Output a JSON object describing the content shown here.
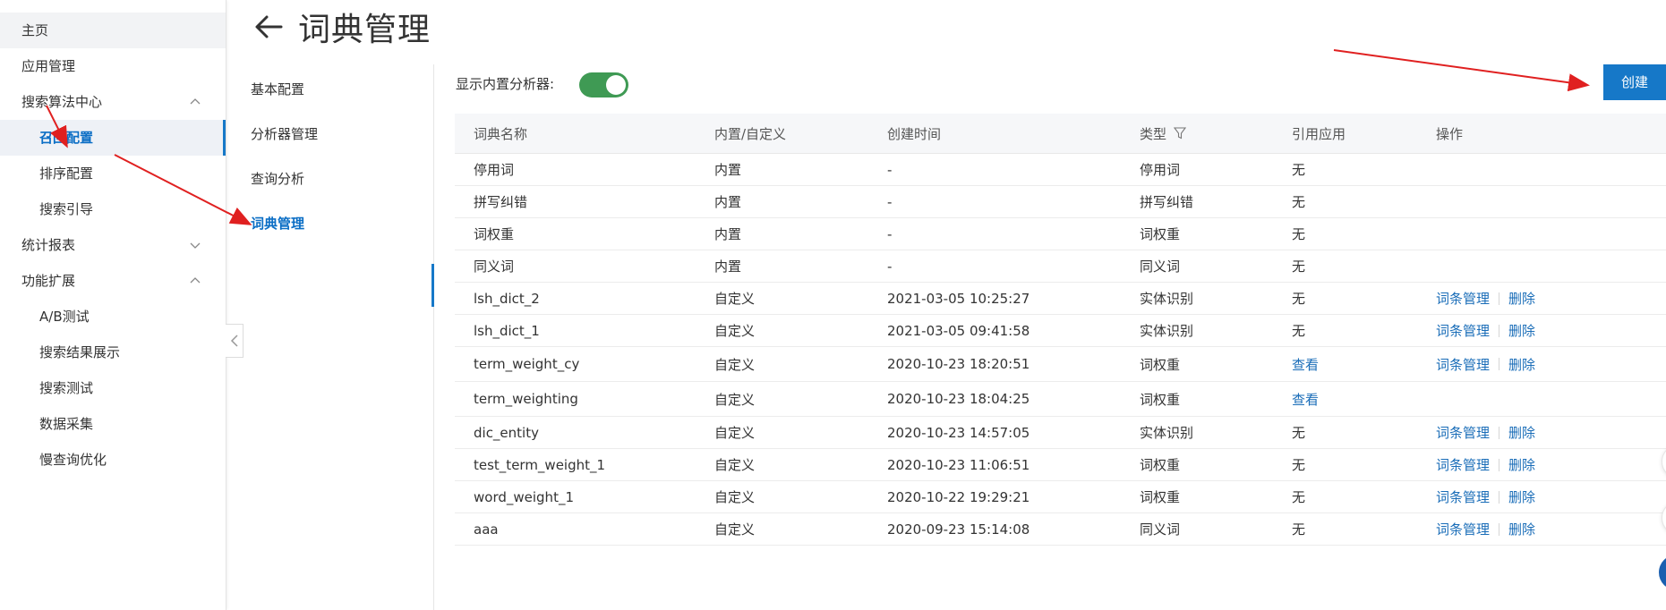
{
  "page": {
    "title": "词典管理"
  },
  "sidebar": {
    "items": [
      {
        "label": "主页",
        "level": "top",
        "chevron": "none",
        "state": "home"
      },
      {
        "label": "应用管理",
        "level": "top",
        "chevron": "none",
        "state": ""
      },
      {
        "label": "搜索算法中心",
        "level": "top",
        "chevron": "up",
        "state": ""
      },
      {
        "label": "召回配置",
        "level": "sub",
        "chevron": "none",
        "state": "active"
      },
      {
        "label": "排序配置",
        "level": "sub",
        "chevron": "none",
        "state": ""
      },
      {
        "label": "搜索引导",
        "level": "sub",
        "chevron": "none",
        "state": ""
      },
      {
        "label": "统计报表",
        "level": "top",
        "chevron": "down",
        "state": ""
      },
      {
        "label": "功能扩展",
        "level": "top",
        "chevron": "up",
        "state": ""
      },
      {
        "label": "A/B测试",
        "level": "sub",
        "chevron": "none",
        "state": ""
      },
      {
        "label": "搜索结果展示",
        "level": "sub",
        "chevron": "none",
        "state": ""
      },
      {
        "label": "搜索测试",
        "level": "sub",
        "chevron": "none",
        "state": ""
      },
      {
        "label": "数据采集",
        "level": "sub",
        "chevron": "none",
        "state": ""
      },
      {
        "label": "慢查询优化",
        "level": "sub",
        "chevron": "none",
        "state": ""
      }
    ]
  },
  "subnav": {
    "items": [
      {
        "label": "基本配置",
        "active": false
      },
      {
        "label": "分析器管理",
        "active": false
      },
      {
        "label": "查询分析",
        "active": false
      },
      {
        "label": "词典管理",
        "active": true
      }
    ]
  },
  "toolbar": {
    "toggle_label": "显示内置分析器:",
    "toggle_on": true,
    "create_label": "创建"
  },
  "table": {
    "headers": [
      "词典名称",
      "内置/自定义",
      "创建时间",
      "类型",
      "引用应用",
      "操作"
    ],
    "rows": [
      {
        "name": "停用词",
        "origin": "内置",
        "created": "-",
        "type": "停用词",
        "ref": "无",
        "ref_link": false,
        "actions": []
      },
      {
        "name": "拼写纠错",
        "origin": "内置",
        "created": "-",
        "type": "拼写纠错",
        "ref": "无",
        "ref_link": false,
        "actions": []
      },
      {
        "name": "词权重",
        "origin": "内置",
        "created": "-",
        "type": "词权重",
        "ref": "无",
        "ref_link": false,
        "actions": []
      },
      {
        "name": "同义词",
        "origin": "内置",
        "created": "-",
        "type": "同义词",
        "ref": "无",
        "ref_link": false,
        "actions": []
      },
      {
        "name": "lsh_dict_2",
        "origin": "自定义",
        "created": "2021-03-05 10:25:27",
        "type": "实体识别",
        "ref": "无",
        "ref_link": false,
        "actions": [
          "词条管理",
          "删除"
        ]
      },
      {
        "name": "lsh_dict_1",
        "origin": "自定义",
        "created": "2021-03-05 09:41:58",
        "type": "实体识别",
        "ref": "无",
        "ref_link": false,
        "actions": [
          "词条管理",
          "删除"
        ]
      },
      {
        "name": "term_weight_cy",
        "origin": "自定义",
        "created": "2020-10-23 18:20:51",
        "type": "词权重",
        "ref": "查看",
        "ref_link": true,
        "actions": [
          "词条管理",
          "删除"
        ]
      },
      {
        "name": "term_weighting",
        "origin": "自定义",
        "created": "2020-10-23 18:04:25",
        "type": "词权重",
        "ref": "查看",
        "ref_link": true,
        "actions": []
      },
      {
        "name": "dic_entity",
        "origin": "自定义",
        "created": "2020-10-23 14:57:05",
        "type": "实体识别",
        "ref": "无",
        "ref_link": false,
        "actions": [
          "词条管理",
          "删除"
        ]
      },
      {
        "name": "test_term_weight_1",
        "origin": "自定义",
        "created": "2020-10-23 11:06:51",
        "type": "词权重",
        "ref": "无",
        "ref_link": false,
        "actions": [
          "词条管理",
          "删除"
        ]
      },
      {
        "name": "word_weight_1",
        "origin": "自定义",
        "created": "2020-10-22 19:29:21",
        "type": "词权重",
        "ref": "无",
        "ref_link": false,
        "actions": [
          "词条管理",
          "删除"
        ]
      },
      {
        "name": "aaa",
        "origin": "自定义",
        "created": "2020-09-23 15:14:08",
        "type": "同义词",
        "ref": "无",
        "ref_link": false,
        "actions": [
          "词条管理",
          "删除"
        ]
      }
    ]
  },
  "colors": {
    "accent": "#1678c8",
    "link": "#1a6db8",
    "toggle_on": "#3f9a54",
    "annotation": "#e02020"
  },
  "icons": {
    "back": "arrow-left-icon",
    "filter": "filter-icon",
    "collapse": "chevron-left-icon"
  }
}
